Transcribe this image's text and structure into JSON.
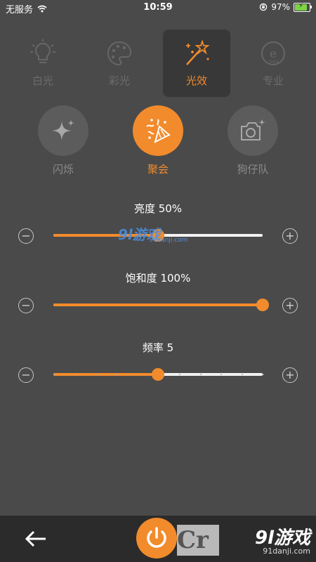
{
  "status_bar": {
    "carrier": "无服务",
    "time": "10:59",
    "battery": "97%"
  },
  "tabs": [
    {
      "label": "白光",
      "icon": "bulb-icon",
      "active": false
    },
    {
      "label": "彩光",
      "icon": "palette-icon",
      "active": false
    },
    {
      "label": "光效",
      "icon": "magic-wand-icon",
      "active": true
    },
    {
      "label": "专业",
      "icon": "pro-logo-icon",
      "active": false
    }
  ],
  "effects": [
    {
      "label": "闪烁",
      "icon": "sparkle-icon",
      "active": false
    },
    {
      "label": "聚会",
      "icon": "party-popper-icon",
      "active": true
    },
    {
      "label": "狗仔队",
      "icon": "camera-icon",
      "active": false
    }
  ],
  "sliders": [
    {
      "title": "亮度 50%",
      "value": 50,
      "max": 100
    },
    {
      "title": "饱和度 100%",
      "value": 100,
      "max": 100
    },
    {
      "title": "频率 5",
      "value": 5,
      "max": 10
    }
  ],
  "watermark": {
    "big": "9l游戏",
    "small": "91danji.com"
  },
  "bottom": {
    "brand": "9l游戏",
    "brand_url": "91danji.com",
    "cr_text": "Cr"
  },
  "colors": {
    "accent": "#f28b2c",
    "background": "#4a4a4a",
    "bottom_bar": "#2b2b2b"
  }
}
